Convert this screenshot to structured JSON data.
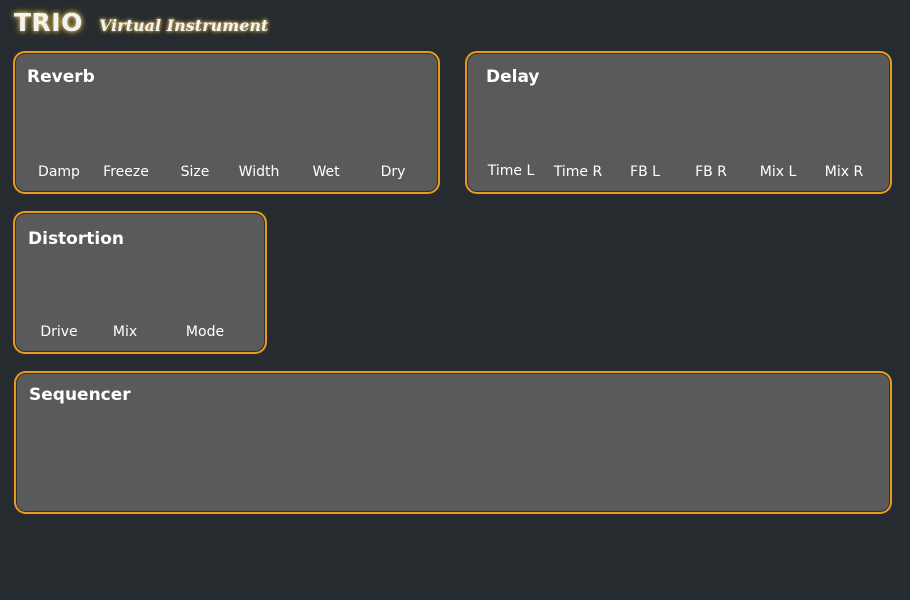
{
  "app": {
    "title": "TRIO",
    "subtitle": "Virtual Instrument"
  },
  "panels": {
    "reverb": {
      "title": "Reverb",
      "labels": [
        "Damp",
        "Freeze",
        "Size",
        "Width",
        "Wet",
        "Dry"
      ]
    },
    "delay": {
      "title": "Delay",
      "labels": [
        "Time L",
        "Time R",
        "FB L",
        "FB R",
        "Mix L",
        "Mix R"
      ]
    },
    "distortion": {
      "title": "Distortion",
      "labels": [
        "Drive",
        "Mix",
        "Mode"
      ]
    },
    "sequencer": {
      "title": "Sequencer"
    }
  },
  "colors": {
    "background": "#262b30",
    "panel": "#5a5a5a",
    "border": "#e99a1c",
    "text": "#ffffff"
  }
}
